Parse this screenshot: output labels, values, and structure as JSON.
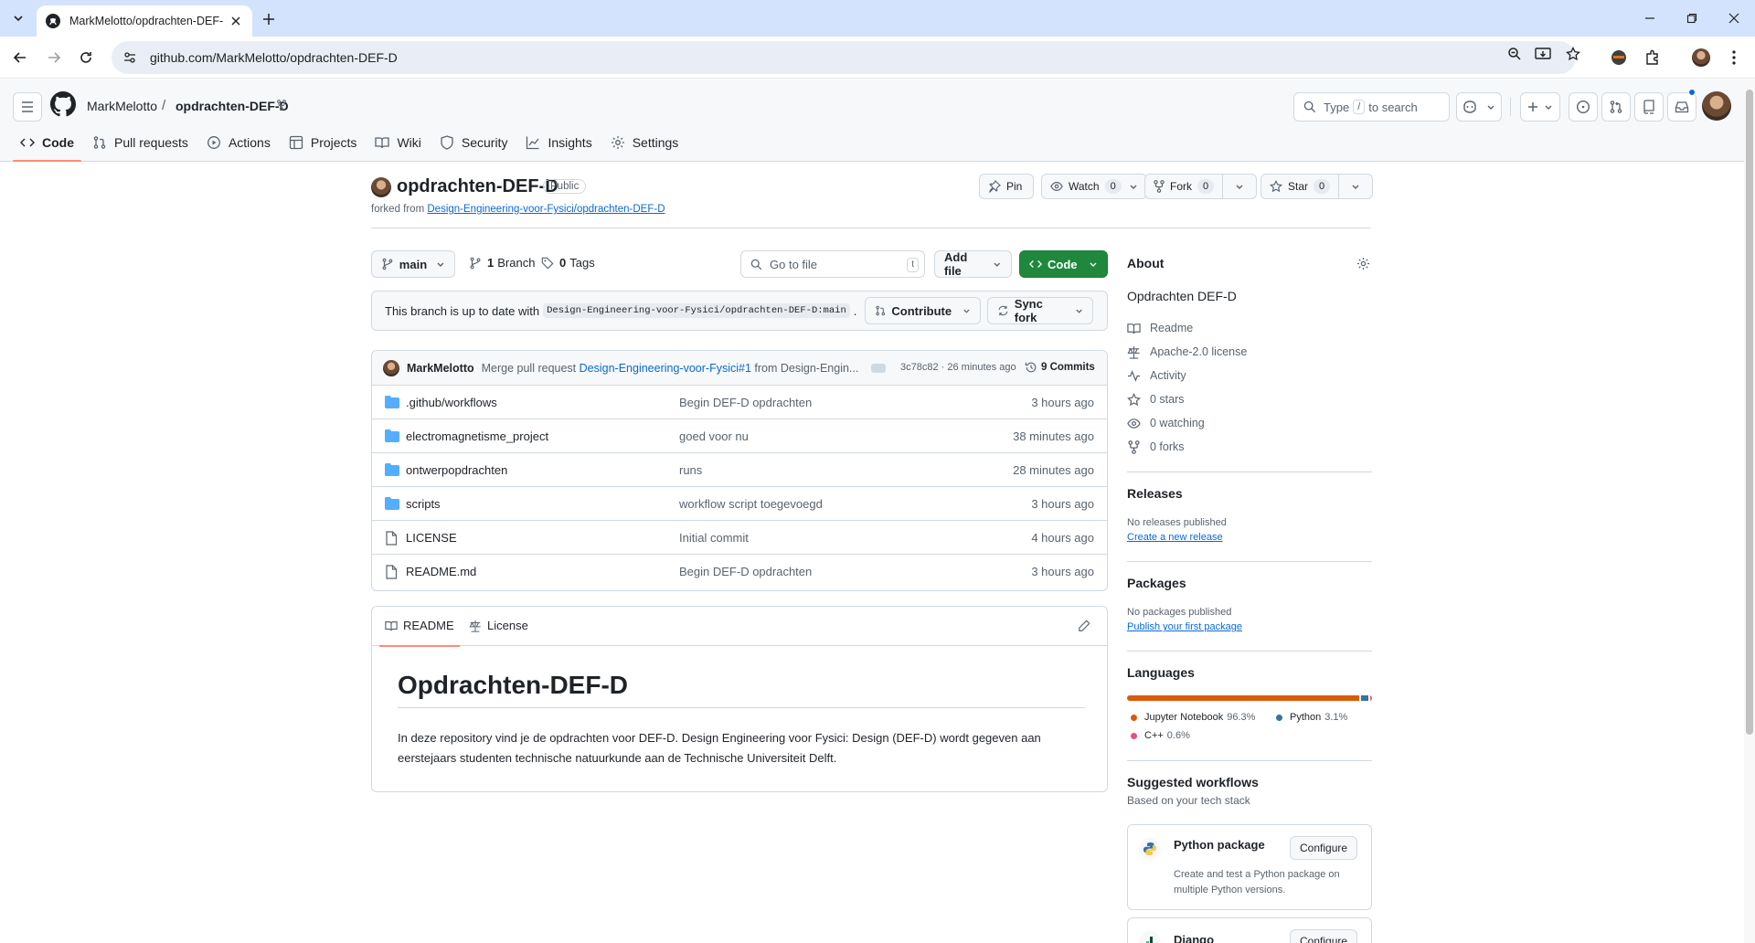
{
  "browser": {
    "tab_title": "MarkMelotto/opdrachten-DEF-",
    "url": "github.com/MarkMelotto/opdrachten-DEF-D"
  },
  "header": {
    "owner": "MarkMelotto",
    "separator": "/",
    "repo": "opdrachten-DEF-D",
    "search_prefix": "Type",
    "search_key": "/",
    "search_suffix": "to search"
  },
  "repo_nav": {
    "code": "Code",
    "pull_requests": "Pull requests",
    "actions": "Actions",
    "projects": "Projects",
    "wiki": "Wiki",
    "security": "Security",
    "insights": "Insights",
    "settings": "Settings"
  },
  "repo": {
    "title": "opdrachten-DEF-D",
    "visibility": "Public",
    "forked_prefix": "forked from",
    "forked_from": "Design-Engineering-voor-Fysici/opdrachten-DEF-D",
    "pin": "Pin",
    "watch": "Watch",
    "watch_count": "0",
    "fork": "Fork",
    "fork_count": "0",
    "star": "Star",
    "star_count": "0"
  },
  "toolbar": {
    "branch": "main",
    "branches_count": "1",
    "branches_label": "Branch",
    "tags_count": "0",
    "tags_label": "Tags",
    "goto_placeholder": "Go to file",
    "goto_key": "t",
    "add_file": "Add file",
    "code": "Code"
  },
  "branch_status": {
    "text": "This branch is up to date with",
    "ref": "Design-Engineering-voor-Fysici/opdrachten-DEF-D:main",
    "period": ".",
    "contribute": "Contribute",
    "sync_fork": "Sync fork"
  },
  "latest_commit": {
    "author": "MarkMelotto",
    "message_prefix": "Merge pull request",
    "pr_link": "Design-Engineering-voor-Fysici#1",
    "message_suffix": "from Design-Engin...",
    "sha_time": "3c78c82 · 26 minutes ago",
    "commits": "9 Commits"
  },
  "files": [
    {
      "name": ".github/workflows",
      "type": "folder",
      "message": "Begin DEF-D opdrachten",
      "age": "3 hours ago"
    },
    {
      "name": "electromagnetisme_project",
      "type": "folder",
      "message": "goed voor nu",
      "age": "38 minutes ago"
    },
    {
      "name": "ontwerpopdrachten",
      "type": "folder",
      "message": "runs",
      "age": "28 minutes ago"
    },
    {
      "name": "scripts",
      "type": "folder",
      "message": "workflow script toegevoegd",
      "age": "3 hours ago"
    },
    {
      "name": "LICENSE",
      "type": "file",
      "message": "Initial commit",
      "age": "4 hours ago"
    },
    {
      "name": "README.md",
      "type": "file",
      "message": "Begin DEF-D opdrachten",
      "age": "3 hours ago"
    }
  ],
  "readme": {
    "tab_readme": "README",
    "tab_license": "License",
    "heading": "Opdrachten-DEF-D",
    "body": "In deze repository vind je de opdrachten voor DEF-D. Design Engineering voor Fysici: Design (DEF-D) wordt gegeven aan eerstejaars studenten technische natuurkunde aan de Technische Universiteit Delft."
  },
  "about": {
    "heading": "About",
    "description": "Opdrachten DEF-D",
    "readme": "Readme",
    "license": "Apache-2.0 license",
    "activity": "Activity",
    "stars": "0 stars",
    "watching": "0 watching",
    "forks": "0 forks"
  },
  "releases": {
    "heading": "Releases",
    "empty": "No releases published",
    "link": "Create a new release"
  },
  "packages": {
    "heading": "Packages",
    "empty": "No packages published",
    "link": "Publish your first package"
  },
  "languages": {
    "heading": "Languages",
    "items": [
      {
        "name": "Jupyter Notebook",
        "percent": "96.3%",
        "value": 96.3,
        "color": "#DA5B0B"
      },
      {
        "name": "Python",
        "percent": "3.1%",
        "value": 3.1,
        "color": "#3572A5"
      },
      {
        "name": "C++",
        "percent": "0.6%",
        "value": 0.6,
        "color": "#f34b7d"
      }
    ]
  },
  "workflows": {
    "heading": "Suggested workflows",
    "subheading": "Based on your tech stack",
    "items": [
      {
        "title": "Python package",
        "description": "Create and test a Python package on multiple Python versions.",
        "button": "Configure"
      },
      {
        "title": "Django",
        "button": "Configure"
      }
    ]
  },
  "colors": {
    "accent": "#0969da",
    "primary_button": "#1f883d",
    "nav_underline": "#fd8c73"
  }
}
